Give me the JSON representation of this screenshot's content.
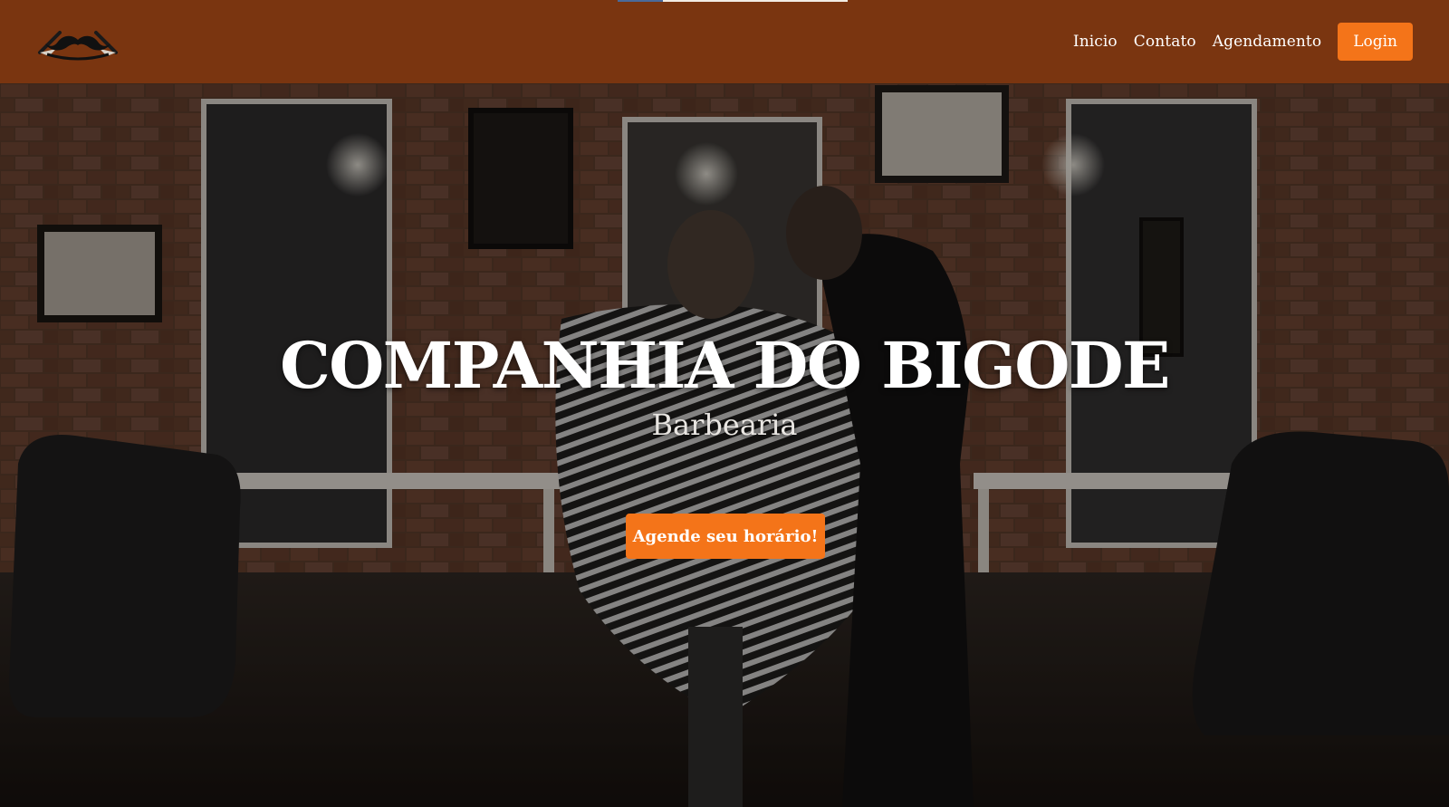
{
  "nav": {
    "logo_icon": "mustache-razor-logo",
    "links": [
      "Inicio",
      "Contato",
      "Agendamento"
    ],
    "login_label": "Login"
  },
  "hero": {
    "title": "COMPANHIA DO BIGODE",
    "subtitle": "Barbearia",
    "cta_label": "Agende seu horário!",
    "background_icon": "barbershop-interior-photo"
  },
  "colors": {
    "navbar": "#7a3510",
    "accent": "#f47419",
    "text": "#ffffff"
  }
}
